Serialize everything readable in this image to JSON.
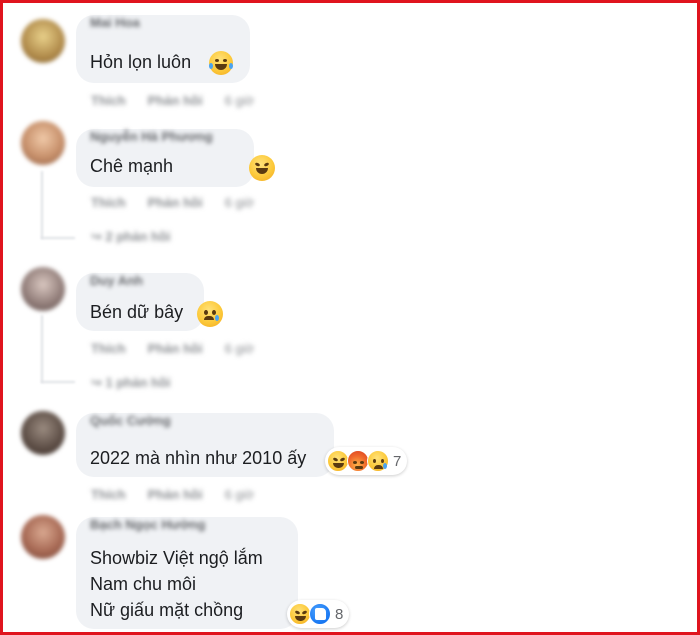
{
  "comments": [
    {
      "author": "Mai Hoa",
      "text_lines": [
        "Hỏn lọn luôn"
      ],
      "actions": {
        "like": "Thích",
        "reply": "Phản hồi",
        "time": "6 giờ"
      },
      "emoji": "laughing-tears"
    },
    {
      "author": "Nguyễn Hà Phương",
      "text_lines": [
        "Chê mạnh"
      ],
      "actions": {
        "like": "Thích",
        "reply": "Phản hồi",
        "time": "6 giờ"
      },
      "emoji": "squinting-laugh",
      "replies": "↪ 2 phản hồi"
    },
    {
      "author": "Duy Anh",
      "text_lines": [
        "Bén dữ bây"
      ],
      "actions": {
        "like": "Thích",
        "reply": "Phản hồi",
        "time": "6 giờ"
      },
      "emoji": "sad-tear",
      "replies": "↪ 1 phản hồi"
    },
    {
      "author": "Quốc Cường",
      "text_lines": [
        "2022 mà nhìn như 2010 ấy"
      ],
      "actions": {
        "like": "Thích",
        "reply": "Phản hồi",
        "time": "6 giờ"
      },
      "reactions": {
        "icons": [
          "haha",
          "angry",
          "sad"
        ],
        "count": "7"
      }
    },
    {
      "author": "Bạch Ngọc Hường",
      "text_lines": [
        "Showbiz Việt ngộ lắm",
        "Nam chu môi",
        "Nữ giấu mặt chồng"
      ],
      "reactions": {
        "icons": [
          "haha",
          "like"
        ],
        "count": "8"
      }
    }
  ],
  "colors": {
    "border": "#e0141e",
    "bubble": "#f0f2f5",
    "text": "#1c1e21",
    "muted": "#8a8d91",
    "like": "#1877f2"
  }
}
